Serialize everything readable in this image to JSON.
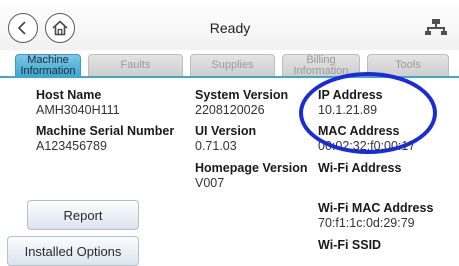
{
  "header": {
    "title": "Ready"
  },
  "tabs": [
    {
      "label": "Machine\nInformation",
      "active": true
    },
    {
      "label": "Faults",
      "active": false
    },
    {
      "label": "Supplies",
      "active": false
    },
    {
      "label": "Billing\nInformation",
      "active": false
    },
    {
      "label": "Tools",
      "active": false
    }
  ],
  "fields": {
    "host_name": {
      "label": "Host Name",
      "value": "AMH3040H111"
    },
    "serial": {
      "label": "Machine Serial Number",
      "value": "A123456789"
    },
    "system_version": {
      "label": "System Version",
      "value": "2208120026"
    },
    "ui_version": {
      "label": "UI Version",
      "value": "0.71.03"
    },
    "homepage_version": {
      "label": "Homepage Version",
      "value": "V007"
    },
    "ip_address": {
      "label": "IP Address",
      "value": "10.1.21.89"
    },
    "mac_address": {
      "label": "MAC Address",
      "value": "00:02:32:f0:00:17"
    },
    "wifi_address": {
      "label": "Wi-Fi Address",
      "value": ""
    },
    "wifi_mac": {
      "label": "Wi-Fi MAC Address",
      "value": "70:f1:1c:0d:29:79"
    },
    "wifi_ssid": {
      "label": "Wi-Fi SSID",
      "value": ""
    }
  },
  "buttons": {
    "report": "Report",
    "installed_options": "Installed Options"
  },
  "icons": {
    "back": "back-arrow-icon",
    "home": "home-icon",
    "network": "network-icon"
  },
  "colors": {
    "tab_active": "#3fa6d0",
    "highlight": "#1a2bd8"
  }
}
